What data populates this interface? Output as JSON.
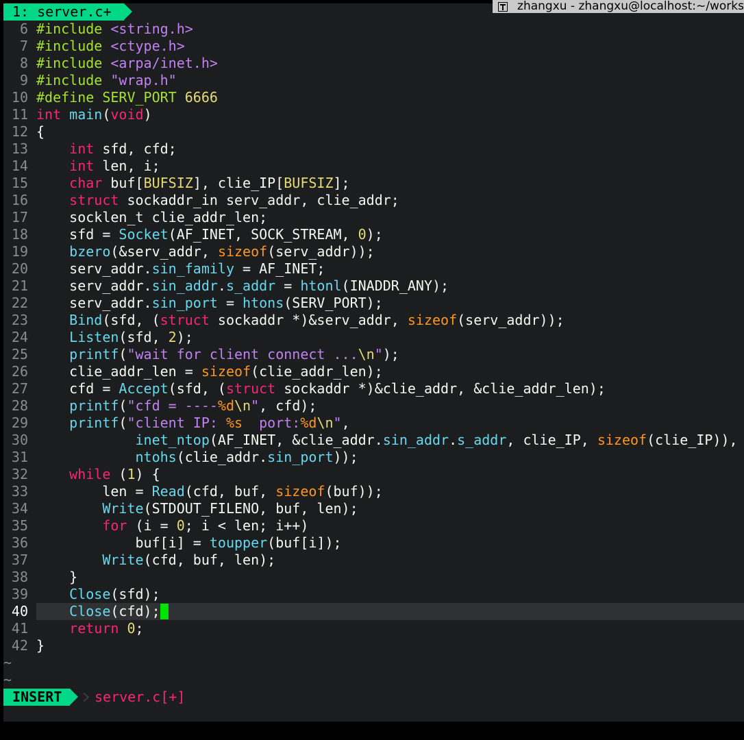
{
  "window": {
    "title": "zhangxu - zhangxu@localhost:~/works"
  },
  "tabline": {
    "buffer_tab": "1: server.c+"
  },
  "editor": {
    "current_line": 40,
    "lines": [
      {
        "n": 6,
        "tokens": [
          [
            "pp",
            "#include "
          ],
          [
            "str",
            "<string.h>"
          ]
        ]
      },
      {
        "n": 7,
        "tokens": [
          [
            "pp",
            "#include "
          ],
          [
            "str",
            "<ctype.h>"
          ]
        ]
      },
      {
        "n": 8,
        "tokens": [
          [
            "pp",
            "#include "
          ],
          [
            "str",
            "<arpa/inet.h>"
          ]
        ]
      },
      {
        "n": 9,
        "tokens": [
          [
            "pp",
            "#include "
          ],
          [
            "str",
            "\"wrap.h\""
          ]
        ]
      },
      {
        "n": 10,
        "tokens": [
          [
            "pp",
            "#define SERV_PORT "
          ],
          [
            "num",
            "6666"
          ]
        ]
      },
      {
        "n": 11,
        "tokens": [
          [
            "kw",
            "int"
          ],
          [
            "",
            " "
          ],
          [
            "fn",
            "main"
          ],
          [
            "",
            "("
          ],
          [
            "kw",
            "void"
          ],
          [
            "",
            ")"
          ]
        ]
      },
      {
        "n": 12,
        "tokens": [
          [
            "",
            "{"
          ]
        ]
      },
      {
        "n": 13,
        "tokens": [
          [
            "",
            "    "
          ],
          [
            "kw",
            "int"
          ],
          [
            "",
            " sfd, cfd;"
          ]
        ]
      },
      {
        "n": 14,
        "tokens": [
          [
            "",
            "    "
          ],
          [
            "kw",
            "int"
          ],
          [
            "",
            " len, i;"
          ]
        ]
      },
      {
        "n": 15,
        "tokens": [
          [
            "",
            "    "
          ],
          [
            "kw",
            "char"
          ],
          [
            "",
            " buf["
          ],
          [
            "cst",
            "BUFSIZ"
          ],
          [
            "",
            "], clie_IP["
          ],
          [
            "cst",
            "BUFSIZ"
          ],
          [
            "",
            "];"
          ]
        ]
      },
      {
        "n": 16,
        "tokens": [
          [
            "",
            "    "
          ],
          [
            "kw",
            "struct"
          ],
          [
            "",
            " sockaddr_in serv_addr, clie_addr;"
          ]
        ]
      },
      {
        "n": 17,
        "tokens": [
          [
            "",
            "    socklen_t clie_addr_len;"
          ]
        ]
      },
      {
        "n": 18,
        "tokens": [
          [
            "",
            "    sfd = "
          ],
          [
            "fn",
            "Socket"
          ],
          [
            "",
            "(AF_INET, SOCK_STREAM, "
          ],
          [
            "num",
            "0"
          ],
          [
            "",
            ");"
          ]
        ]
      },
      {
        "n": 19,
        "tokens": [
          [
            "",
            "    "
          ],
          [
            "fn",
            "bzero"
          ],
          [
            "",
            "(&serv_addr, "
          ],
          [
            "sz",
            "sizeof"
          ],
          [
            "",
            "(serv_addr));"
          ]
        ]
      },
      {
        "n": 20,
        "tokens": [
          [
            "",
            "    serv_addr."
          ],
          [
            "mem",
            "sin_family"
          ],
          [
            "",
            " = AF_INET;"
          ]
        ]
      },
      {
        "n": 21,
        "tokens": [
          [
            "",
            "    serv_addr."
          ],
          [
            "mem",
            "sin_addr"
          ],
          [
            "",
            "."
          ],
          [
            "mem",
            "s_addr"
          ],
          [
            "",
            " = "
          ],
          [
            "fn",
            "htonl"
          ],
          [
            "",
            "(INADDR_ANY);"
          ]
        ]
      },
      {
        "n": 22,
        "tokens": [
          [
            "",
            "    serv_addr."
          ],
          [
            "mem",
            "sin_port"
          ],
          [
            "",
            " = "
          ],
          [
            "fn",
            "htons"
          ],
          [
            "",
            "(SERV_PORT);"
          ]
        ]
      },
      {
        "n": 23,
        "tokens": [
          [
            "",
            "    "
          ],
          [
            "fn",
            "Bind"
          ],
          [
            "",
            "(sfd, ("
          ],
          [
            "kw",
            "struct"
          ],
          [
            "",
            " sockaddr *)&serv_addr, "
          ],
          [
            "sz",
            "sizeof"
          ],
          [
            "",
            "(serv_addr));"
          ]
        ]
      },
      {
        "n": 24,
        "tokens": [
          [
            "",
            "    "
          ],
          [
            "fn",
            "Listen"
          ],
          [
            "",
            "(sfd, "
          ],
          [
            "num",
            "2"
          ],
          [
            "",
            ");"
          ]
        ]
      },
      {
        "n": 25,
        "tokens": [
          [
            "",
            "    "
          ],
          [
            "fn",
            "printf"
          ],
          [
            "",
            "("
          ],
          [
            "str",
            "\"wait for client connect ..."
          ],
          [
            "esc",
            "\\n"
          ],
          [
            "str",
            "\""
          ],
          [
            "",
            ");"
          ]
        ]
      },
      {
        "n": 26,
        "tokens": [
          [
            "",
            "    clie_addr_len = "
          ],
          [
            "sz",
            "sizeof"
          ],
          [
            "",
            "(clie_addr_len);"
          ]
        ]
      },
      {
        "n": 27,
        "tokens": [
          [
            "",
            "    cfd = "
          ],
          [
            "fn",
            "Accept"
          ],
          [
            "",
            "(sfd, ("
          ],
          [
            "kw",
            "struct"
          ],
          [
            "",
            " sockaddr *)&clie_addr, &clie_addr_len);"
          ]
        ]
      },
      {
        "n": 28,
        "tokens": [
          [
            "",
            "    "
          ],
          [
            "fn",
            "printf"
          ],
          [
            "",
            "("
          ],
          [
            "str",
            "\"cfd = ----"
          ],
          [
            "sz",
            "%d"
          ],
          [
            "esc",
            "\\n"
          ],
          [
            "str",
            "\""
          ],
          [
            "",
            ", cfd);"
          ]
        ]
      },
      {
        "n": 29,
        "tokens": [
          [
            "",
            "    "
          ],
          [
            "fn",
            "printf"
          ],
          [
            "",
            "("
          ],
          [
            "str",
            "\"client IP: "
          ],
          [
            "sz",
            "%s"
          ],
          [
            "str",
            "  port:"
          ],
          [
            "sz",
            "%d"
          ],
          [
            "esc",
            "\\n"
          ],
          [
            "str",
            "\""
          ],
          [
            "",
            ","
          ]
        ]
      },
      {
        "n": 30,
        "tokens": [
          [
            "",
            "            "
          ],
          [
            "fn",
            "inet_ntop"
          ],
          [
            "",
            "(AF_INET, &clie_addr."
          ],
          [
            "mem",
            "sin_addr"
          ],
          [
            "",
            "."
          ],
          [
            "mem",
            "s_addr"
          ],
          [
            "",
            ", clie_IP, "
          ],
          [
            "sz",
            "sizeof"
          ],
          [
            "",
            "(clie_IP)),"
          ]
        ]
      },
      {
        "n": 31,
        "tokens": [
          [
            "",
            "            "
          ],
          [
            "fn",
            "ntohs"
          ],
          [
            "",
            "(clie_addr."
          ],
          [
            "mem",
            "sin_port"
          ],
          [
            "",
            "));"
          ]
        ]
      },
      {
        "n": 32,
        "tokens": [
          [
            "",
            "    "
          ],
          [
            "kw",
            "while"
          ],
          [
            "",
            " ("
          ],
          [
            "num",
            "1"
          ],
          [
            "",
            ") {"
          ]
        ]
      },
      {
        "n": 33,
        "tokens": [
          [
            "",
            "        len = "
          ],
          [
            "fn",
            "Read"
          ],
          [
            "",
            "(cfd, buf, "
          ],
          [
            "sz",
            "sizeof"
          ],
          [
            "",
            "(buf));"
          ]
        ]
      },
      {
        "n": 34,
        "tokens": [
          [
            "",
            "        "
          ],
          [
            "fn",
            "Write"
          ],
          [
            "",
            "(STDOUT_FILENO, buf, len);"
          ]
        ]
      },
      {
        "n": 35,
        "tokens": [
          [
            "",
            "        "
          ],
          [
            "kw",
            "for"
          ],
          [
            "",
            " (i = "
          ],
          [
            "num",
            "0"
          ],
          [
            "",
            "; i < len; i++)"
          ]
        ]
      },
      {
        "n": 36,
        "tokens": [
          [
            "",
            "            buf[i] = "
          ],
          [
            "fn",
            "toupper"
          ],
          [
            "",
            "(buf[i]);"
          ]
        ]
      },
      {
        "n": 37,
        "tokens": [
          [
            "",
            "        "
          ],
          [
            "fn",
            "Write"
          ],
          [
            "",
            "(cfd, buf, len);"
          ]
        ]
      },
      {
        "n": 38,
        "tokens": [
          [
            "",
            "    }"
          ]
        ]
      },
      {
        "n": 39,
        "tokens": [
          [
            "",
            "    "
          ],
          [
            "fn",
            "Close"
          ],
          [
            "",
            "(sfd);"
          ]
        ]
      },
      {
        "n": 40,
        "tokens": [
          [
            "",
            "    "
          ],
          [
            "fn",
            "Close"
          ],
          [
            "",
            "(cfd);"
          ]
        ],
        "cursor": true
      },
      {
        "n": 41,
        "tokens": [
          [
            "",
            "    "
          ],
          [
            "kw",
            "return"
          ],
          [
            "",
            " "
          ],
          [
            "num",
            "0"
          ],
          [
            "",
            ";"
          ]
        ]
      },
      {
        "n": 42,
        "tokens": [
          [
            "",
            "}"
          ]
        ]
      }
    ],
    "filler": [
      "~",
      "~"
    ]
  },
  "statusline": {
    "mode": "INSERT",
    "file": "server.c[+]"
  },
  "colors": {
    "accent_green": "#00d787",
    "cursor_green": "#00e400",
    "background": "#1b1d1e",
    "keyword": "#f92672",
    "function": "#66d9ef",
    "string": "#c182f2",
    "number": "#e6db74",
    "preprocessor": "#a6e22e",
    "sizeof": "#fd971f"
  }
}
